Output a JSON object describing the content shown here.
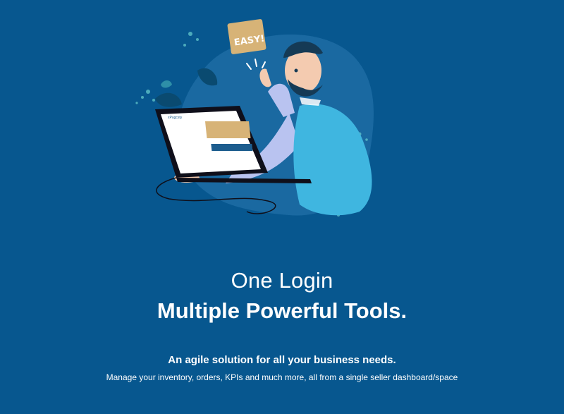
{
  "hero": {
    "sign_text": "EASY!",
    "screen_brand": "xPugcsty",
    "heading_line1": "One Login",
    "heading_line2": "Multiple Powerful Tools.",
    "tagline": "An agile solution for all your business needs.",
    "description": "Manage your inventory, orders, KPIs and much more, all from a single seller dashboard/space"
  },
  "colors": {
    "background": "#07578f",
    "text": "#ffffff",
    "blob": "#1d6ba3",
    "vest": "#3fb6e0",
    "shirt": "#b9c3f0",
    "screen_card": "#d7b377",
    "screen_button": "#1d5d8e"
  },
  "icons": [
    "person-illustration",
    "monitor-illustration",
    "sign-illustration",
    "leaf-decoration"
  ]
}
